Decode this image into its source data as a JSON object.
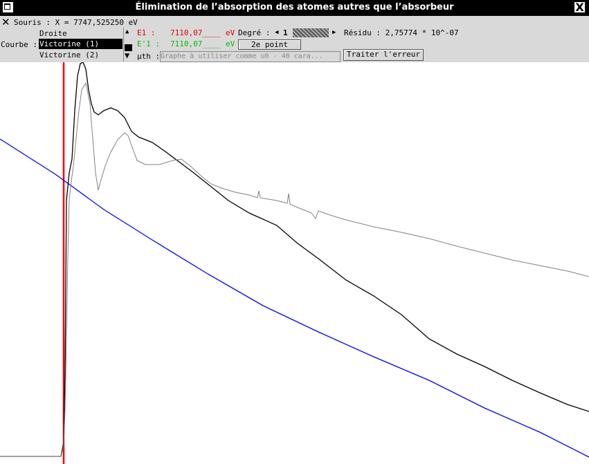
{
  "window": {
    "title": "Élimination de l’absorption des atomes autres que l’absorbeur",
    "close_glyph": "X"
  },
  "toolbar": {
    "mouse_label": "Souris : X = 7747,525250 eV",
    "curve_label": "Courbe :",
    "curves": [
      "Droite",
      "Victorine (1)",
      "Victorine (2)"
    ],
    "selected_curve": "Victorine (1)",
    "e1_label": "E1  :",
    "e1_value": "7110,07____",
    "e1_unit": "eV",
    "e1p_label": "E'1 :",
    "e1p_value": "7110,07____",
    "e1p_unit": "eV",
    "degre_label": "Degré :",
    "degre_value": "1",
    "residu_label": "Résidu : 2,75774 * 10^-07",
    "second_point_button": "2e point",
    "uth_label": "μth :",
    "uth_placeholder": "Graphe à utiliser comme u0 - 40 cara...",
    "traiter_button": "Traiter l'erreur"
  },
  "plot": {
    "colors": {
      "marker": "#ff0000",
      "baseline": "#0000ff",
      "curve1": "#000000",
      "curve2": "#808080"
    }
  }
}
